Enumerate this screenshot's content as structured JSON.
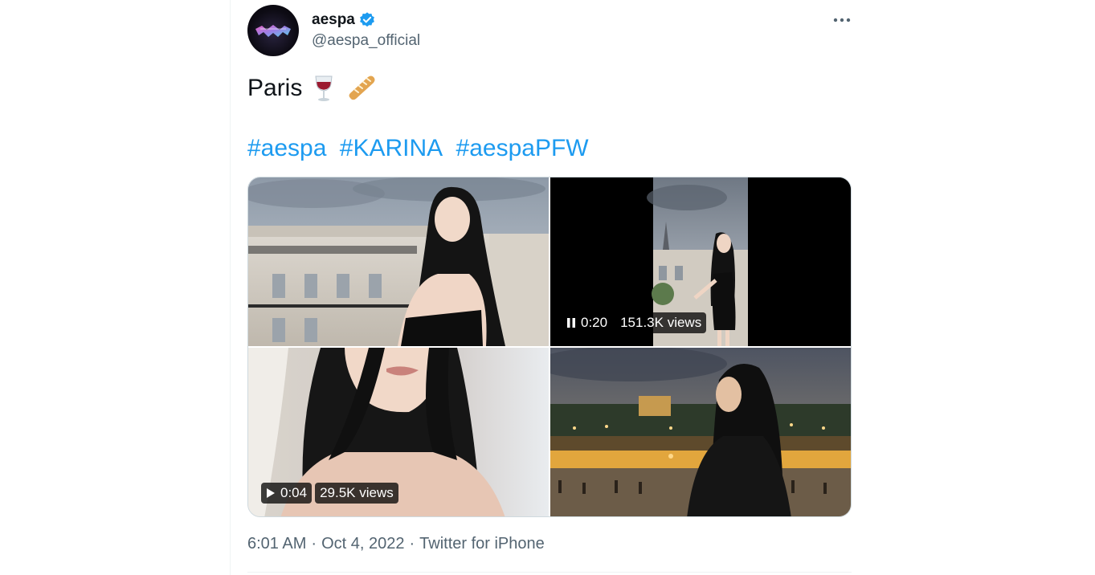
{
  "account": {
    "display_name": "aespa",
    "handle": "@aespa_official",
    "verified": true
  },
  "tweet": {
    "text": "Paris",
    "emojis": [
      "wine-glass",
      "baguette"
    ],
    "hashtags": [
      "#aespa",
      "#KARINA",
      "#aespaPFW"
    ]
  },
  "media": [
    {
      "kind": "photo",
      "description": "woman-on-paris-balcony"
    },
    {
      "kind": "video",
      "state": "playing",
      "duration": "0:20",
      "views": "151.3K views"
    },
    {
      "kind": "video",
      "state": "paused",
      "duration": "0:04",
      "views": "29.5K views"
    },
    {
      "kind": "photo",
      "description": "woman-at-night-by-seine"
    }
  ],
  "meta": {
    "time": "6:01 AM",
    "separator": "·",
    "date": "Oct 4, 2022",
    "source": "Twitter for iPhone"
  },
  "colors": {
    "accent": "#1d9bf0",
    "text": "#0f1419",
    "secondary": "#536471"
  },
  "icons": {
    "verified": "verified-badge-icon",
    "more": "more-options-icon",
    "pause": "pause-icon",
    "play": "play-icon"
  }
}
